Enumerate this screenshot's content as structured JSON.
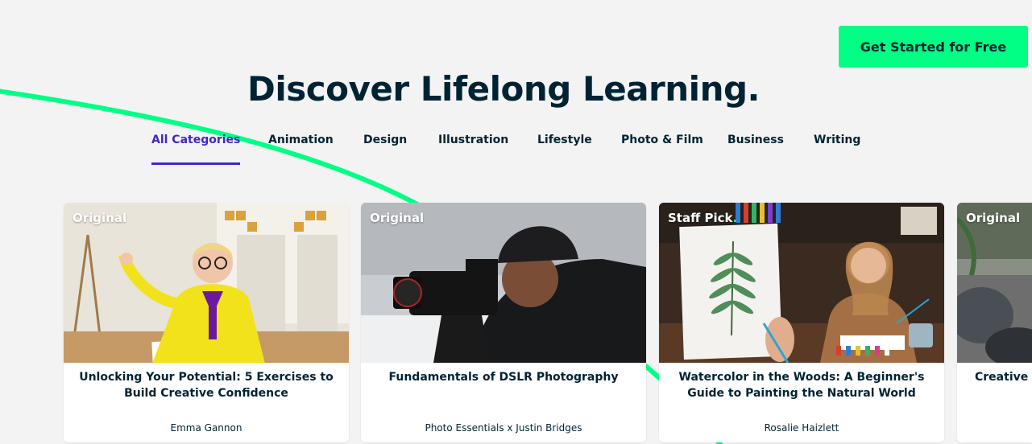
{
  "header": {
    "cta_label": "Get Started for Free",
    "headline": "Discover Lifelong Learning."
  },
  "categories": {
    "active": "All Categories",
    "tabs": [
      {
        "label": "All Categories"
      },
      {
        "label": "Animation"
      },
      {
        "label": "Design"
      },
      {
        "label": "Illustration"
      },
      {
        "label": "Lifestyle"
      },
      {
        "label": "Photo & Film"
      },
      {
        "label": "Business"
      },
      {
        "label": "Writing"
      }
    ]
  },
  "classes": [
    {
      "badge": "Original",
      "title": "Unlocking Your Potential: 5 Exercises to Build Creative Confidence",
      "author": "Emma Gannon"
    },
    {
      "badge": "Original",
      "title": "Fundamentals of DSLR Photography",
      "author": "Photo Essentials x Justin Bridges"
    },
    {
      "badge": "Staff Pick",
      "badge_suffix": ".",
      "title": "Watercolor in the Woods: A Beginner's Guide to Painting the Natural World",
      "author": "Rosalie Haizlett"
    },
    {
      "badge": "Original",
      "title": "Creative V",
      "author": ""
    }
  ],
  "colors": {
    "accent_green": "#00ff84",
    "active_tab": "#3d27c9",
    "text_dark": "#002333",
    "background": "#f3f3f3"
  }
}
